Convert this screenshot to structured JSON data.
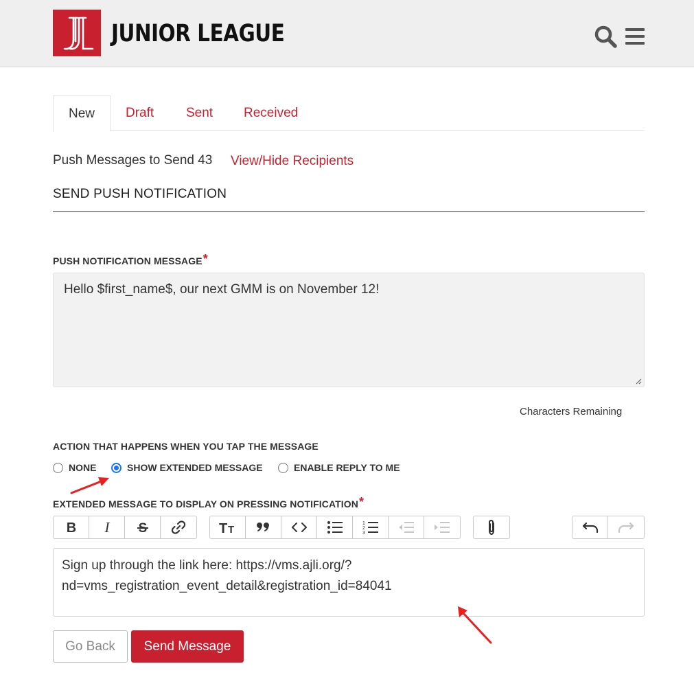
{
  "header": {
    "brand": "JUNIOR LEAGUE",
    "logo_icon": "junior-league-logo",
    "search_icon": "search-icon",
    "menu_icon": "hamburger-menu-icon",
    "brand_color": "#c8202f"
  },
  "tabs": [
    {
      "label": "New",
      "active": true
    },
    {
      "label": "Draft",
      "active": false
    },
    {
      "label": "Sent",
      "active": false
    },
    {
      "label": "Received",
      "active": false
    }
  ],
  "summary": {
    "text": "Push Messages to Send 43",
    "view_link": "View/Hide Recipients"
  },
  "section": {
    "title": "SEND PUSH NOTIFICATION"
  },
  "push_message": {
    "label": "PUSH NOTIFICATION MESSAGE",
    "required_mark": "*",
    "value": "Hello $first_name$, our next GMM is on November 12!",
    "chars_remaining_label": "Characters Remaining"
  },
  "action": {
    "label": "ACTION THAT HAPPENS WHEN YOU TAP THE MESSAGE",
    "options": [
      {
        "label": "NONE",
        "checked": false
      },
      {
        "label": "SHOW EXTENDED MESSAGE",
        "checked": true
      },
      {
        "label": "ENABLE REPLY TO ME",
        "checked": false
      }
    ]
  },
  "extended": {
    "label": "EXTENDED MESSAGE TO DISPLAY ON PRESSING NOTIFICATION",
    "required_mark": "*",
    "line1": "Sign up through the link here: https://vms.ajli.org/?",
    "line2": "nd=vms_registration_event_detail&registration_id=84041"
  },
  "toolbar": {
    "icons": [
      "bold-icon",
      "italic-icon",
      "strikethrough-icon",
      "link-icon",
      "heading-icon",
      "quote-icon",
      "code-icon",
      "bullet-list-icon",
      "numbered-list-icon",
      "outdent-icon",
      "indent-icon",
      "attach-file-icon",
      "undo-icon",
      "redo-icon"
    ]
  },
  "buttons": {
    "back": "Go Back",
    "send": "Send Message"
  },
  "colors": {
    "accent": "#c8202f",
    "radio_selected": "#1a73e8",
    "annotation_arrow": "#e8201f"
  }
}
